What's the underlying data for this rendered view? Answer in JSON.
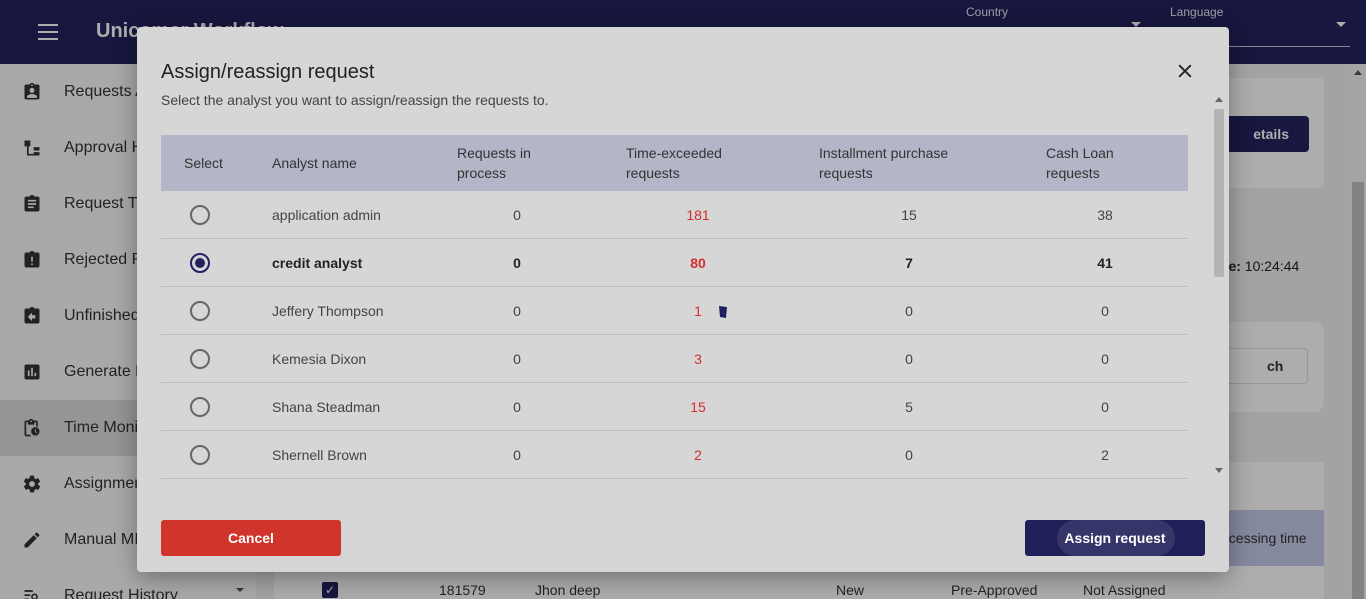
{
  "app": {
    "title": "Unicomer Workflow",
    "country_label": "Country",
    "language_label": "Language"
  },
  "sidebar": {
    "items": [
      {
        "label": "Requests Assigned",
        "icon": "assignment-ind-icon"
      },
      {
        "label": "Approval Hierarchy",
        "icon": "hierarchy-icon"
      },
      {
        "label": "Request Tracking",
        "icon": "assignment-icon"
      },
      {
        "label": "Rejected Requests",
        "icon": "assignment-late-icon"
      },
      {
        "label": "Unfinished Requests",
        "icon": "assignment-return-icon"
      },
      {
        "label": "Generate Reports",
        "icon": "report-chart-icon"
      },
      {
        "label": "Time Monitoring",
        "icon": "clipboard-clock-icon"
      },
      {
        "label": "Assignment Settings",
        "icon": "gear-icon"
      },
      {
        "label": "Manual MI",
        "icon": "pencil-icon"
      },
      {
        "label": "Request History",
        "icon": "history-search-icon"
      }
    ],
    "active_index": 6
  },
  "background": {
    "details_button": "etails",
    "time_label": "me:",
    "time_value": "10:24:44",
    "search_button": "ch",
    "processing_time_header": "ocessing time",
    "row": {
      "id": "181579",
      "name": "Jhon deep",
      "status": "New",
      "stage": "Pre-Approved",
      "assignment": "Not Assigned"
    }
  },
  "dialog": {
    "title": "Assign/reassign request",
    "subtitle": "Select the analyst you want to assign/reassign the requests to.",
    "columns": {
      "select": "Select",
      "analyst": "Analyst name",
      "in_process_1": "Requests in",
      "in_process_2": "process",
      "exceeded_1": "Time-exceeded",
      "exceeded_2": "requests",
      "installment_1": "Installment purchase",
      "installment_2": "requests",
      "cash_1": "Cash Loan",
      "cash_2": "requests"
    },
    "rows": [
      {
        "name": "application admin",
        "in_process": "0",
        "exceeded": "181",
        "installment": "15",
        "cash": "38",
        "selected": false
      },
      {
        "name": "credit analyst",
        "in_process": "0",
        "exceeded": "80",
        "installment": "7",
        "cash": "41",
        "selected": true
      },
      {
        "name": "Jeffery Thompson",
        "in_process": "0",
        "exceeded": "1",
        "installment": "0",
        "cash": "0",
        "selected": false
      },
      {
        "name": "Kemesia Dixon",
        "in_process": "0",
        "exceeded": "3",
        "installment": "0",
        "cash": "0",
        "selected": false
      },
      {
        "name": "Shana Steadman",
        "in_process": "0",
        "exceeded": "15",
        "installment": "5",
        "cash": "0",
        "selected": false
      },
      {
        "name": "Shernell Brown",
        "in_process": "0",
        "exceeded": "2",
        "installment": "0",
        "cash": "2",
        "selected": false
      }
    ],
    "cancel_label": "Cancel",
    "assign_label": "Assign request"
  },
  "colors": {
    "brand": "#22225e",
    "danger": "#d1342a",
    "exceeded_text": "#d32f2f"
  }
}
